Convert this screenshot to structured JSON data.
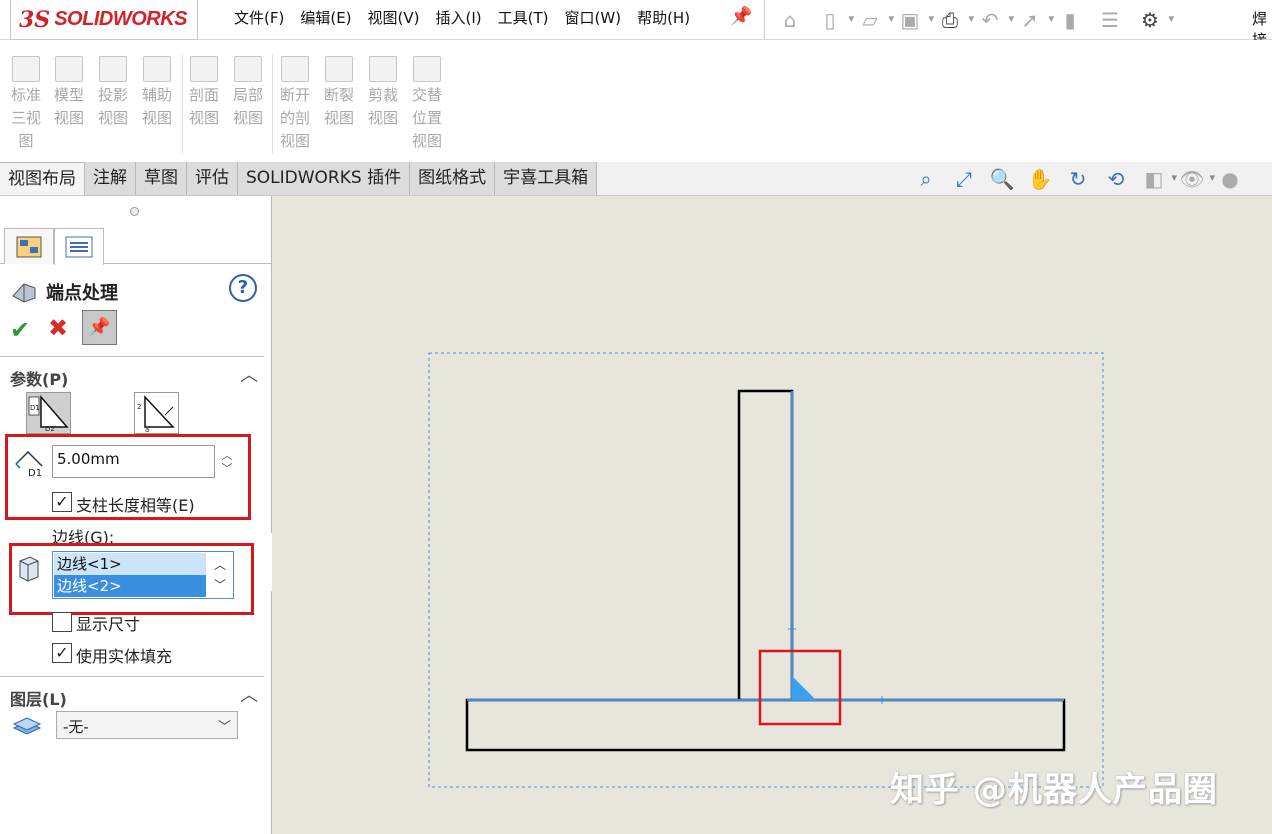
{
  "app": {
    "logo_ds": "3S",
    "logo_name": "SOLIDWORKS"
  },
  "menu": [
    "文件(F)",
    "编辑(E)",
    "视图(V)",
    "插入(I)",
    "工具(T)",
    "窗口(W)",
    "帮助(H)"
  ],
  "topbar": {
    "cut_text": "焊接"
  },
  "ribbon": {
    "buttons": [
      {
        "lines": [
          "标准",
          "三视",
          "图"
        ]
      },
      {
        "lines": [
          "模型",
          "视图"
        ]
      },
      {
        "lines": [
          "投影",
          "视图"
        ]
      },
      {
        "lines": [
          "辅助",
          "视图"
        ]
      },
      {
        "lines": [
          "剖面",
          "视图"
        ]
      },
      {
        "lines": [
          "局部",
          "视图"
        ]
      },
      {
        "lines": [
          "断开",
          "的剖",
          "视图"
        ]
      },
      {
        "lines": [
          "断裂",
          "视图"
        ]
      },
      {
        "lines": [
          "剪裁",
          "视图"
        ]
      },
      {
        "lines": [
          "交替",
          "位置",
          "视图"
        ]
      }
    ]
  },
  "tabs": [
    "视图布局",
    "注解",
    "草图",
    "评估",
    "SOLIDWORKS 插件",
    "图纸格式",
    "宇喜工具箱"
  ],
  "panel": {
    "title": "端点处理",
    "help": "?",
    "params": {
      "header": "参数(P)",
      "d1_label": "D1",
      "d1_value": "5.00mm",
      "equal_length_label": "支柱长度相等(E)",
      "equal_length_checked": true,
      "edges_label": "边线(G):",
      "edges": [
        "边线<1>",
        "边线<2>"
      ],
      "show_dim_label": "显示尺寸",
      "show_dim_checked": false,
      "solid_fill_label": "使用实体填充",
      "solid_fill_checked": true
    },
    "layers": {
      "header": "图层(L)",
      "value": "-无-"
    }
  },
  "watermark": "知乎 @机器人产品圈",
  "colors": {
    "accent": "#2b62b8",
    "highlight": "#d3191e",
    "fillet": "#3b9ff0",
    "canvas_bg": "#e8e6dc"
  }
}
